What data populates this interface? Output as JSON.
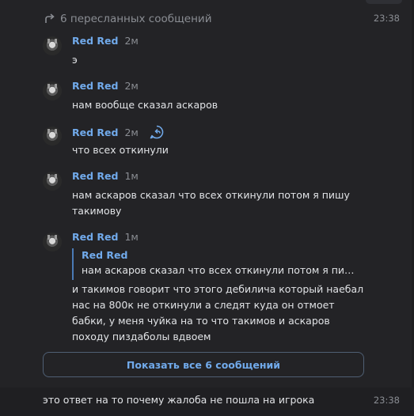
{
  "colors": {
    "background": "#232326",
    "accent": "#71aaeb",
    "muted": "#8a8d93",
    "text": "#e1e3e6"
  },
  "forward": {
    "header": "6 пересланных сообщений",
    "time": "23:38",
    "messages": [
      {
        "author": "Red Red",
        "ago": "2м",
        "text": "э"
      },
      {
        "author": "Red Red",
        "ago": "2м",
        "text": "нам вообще сказал аскаров"
      },
      {
        "author": "Red Red",
        "ago": "2м",
        "text": "что всех откинули",
        "icon": "reply-bubble-icon"
      },
      {
        "author": "Red Red",
        "ago": "1м",
        "text": "нам аскаров сказал что всех откинули потом я пишу такимову"
      },
      {
        "author": "Red Red",
        "ago": "1м",
        "reply": {
          "author": "Red Red",
          "text": "нам аскаров сказал что всех откинули потом я пи…"
        },
        "text": "и такимов говорит что этого дебилича который наебал нас на 800к не откинули а следят куда он отмоет бабки, у меня чуйка на то что такимов и аскаров походу пиздаболы вдвоем"
      }
    ],
    "show_all": "Показать все 6 сообщений"
  },
  "bottom_message": {
    "text": "это ответ на то почему жалоба не пошла на игрока",
    "time": "23:38"
  }
}
